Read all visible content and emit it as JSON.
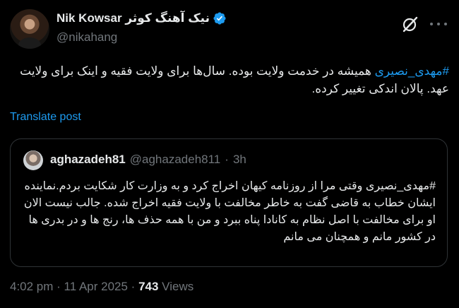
{
  "author": {
    "name": "Nik Kowsar نیک آهنگ کوثر",
    "handle": "@nikahang",
    "verified": true
  },
  "tweet": {
    "hashtag": "#مهدی_نصیری",
    "text": " همیشه در خدمت ولایت بوده. سال‌ها برای ولایت فقیه و اینک برای ولایت عهد. پالان اندکی تغییر کرده."
  },
  "translate_label": "Translate post",
  "quote": {
    "name": "aghazadeh81",
    "handle": "@aghazadeh811",
    "separator": "·",
    "time": "3h",
    "hashtag": "#مهدی_نصیری",
    "text": " وقتی مرا از روزنامه کیهان اخراج کرد و به وزارت کار شکایت بردم.نماینده ایشان خطاب به قاضی گفت به خاطر مخالفت با ولایت فقیه اخراج شده. جالب نیست الان او برای مخالفت با اصل نظام به کانادا پناه ببرد و من با همه حذف ها، رنج ها و در بدری ها در کشور مانم و همچنان می مانم"
  },
  "footer": {
    "time": "4:02 pm · 11 Apr 2025 · ",
    "views_count": "743",
    "views_label": " Views"
  },
  "icons": {
    "grok": "grok-icon",
    "more": "more-icon",
    "verified": "verified-badge-icon"
  },
  "colors": {
    "background": "#000000",
    "text": "#e7e9ea",
    "secondary": "#71767b",
    "accent": "#1d9bf0",
    "border": "#2f3336"
  }
}
